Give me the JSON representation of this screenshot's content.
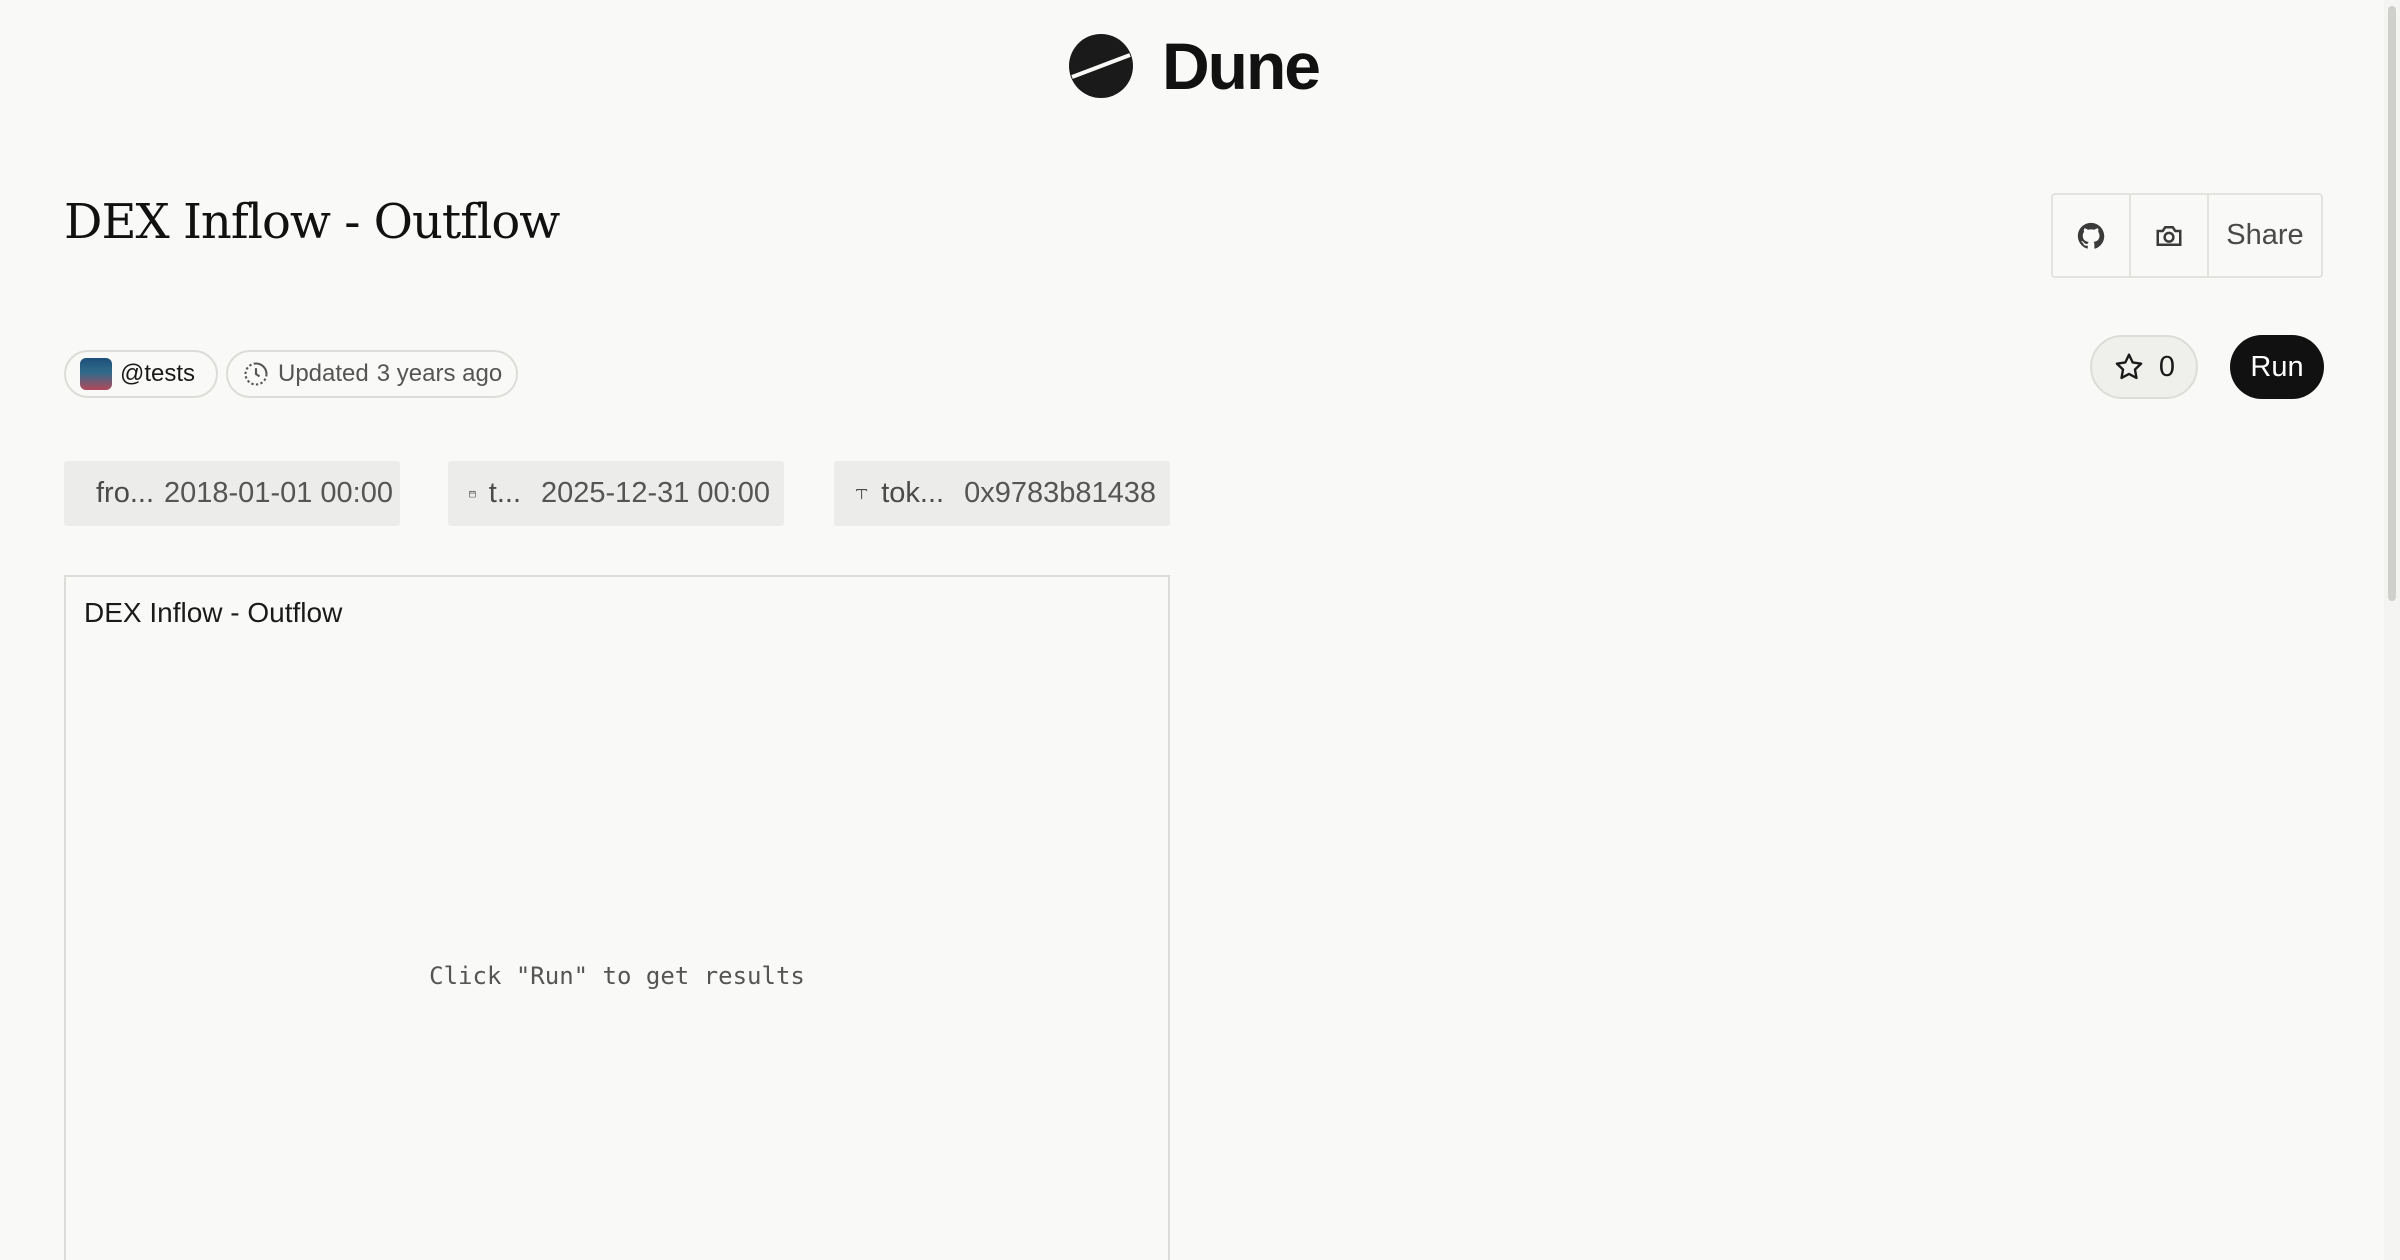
{
  "brand": {
    "name": "Dune",
    "logo_icon": "dune-logo-icon"
  },
  "query": {
    "title": "DEX Inflow - Outflow"
  },
  "actions": {
    "github_icon": "github-icon",
    "camera_icon": "camera-icon",
    "share_label": "Share",
    "star_count": "0",
    "run_label": "Run"
  },
  "meta": {
    "owner": "@tests",
    "updated_label": "Updated",
    "updated_value": "3 years ago"
  },
  "parameters": [
    {
      "icon": "calendar-icon",
      "name": "fro...",
      "value": "2018-01-01 00:00"
    },
    {
      "icon": "calendar-icon",
      "name": "t...",
      "value": "2025-12-31 00:00"
    },
    {
      "icon": "text-type-icon",
      "name": "tok...",
      "value": "0x9783b81438"
    }
  ],
  "visualization": {
    "title": "DEX Inflow - Outflow",
    "empty_message": "Click \"Run\" to get results"
  },
  "colors": {
    "accent": "#111111",
    "background": "#f9f9f7",
    "param_bg": "#ececea"
  }
}
